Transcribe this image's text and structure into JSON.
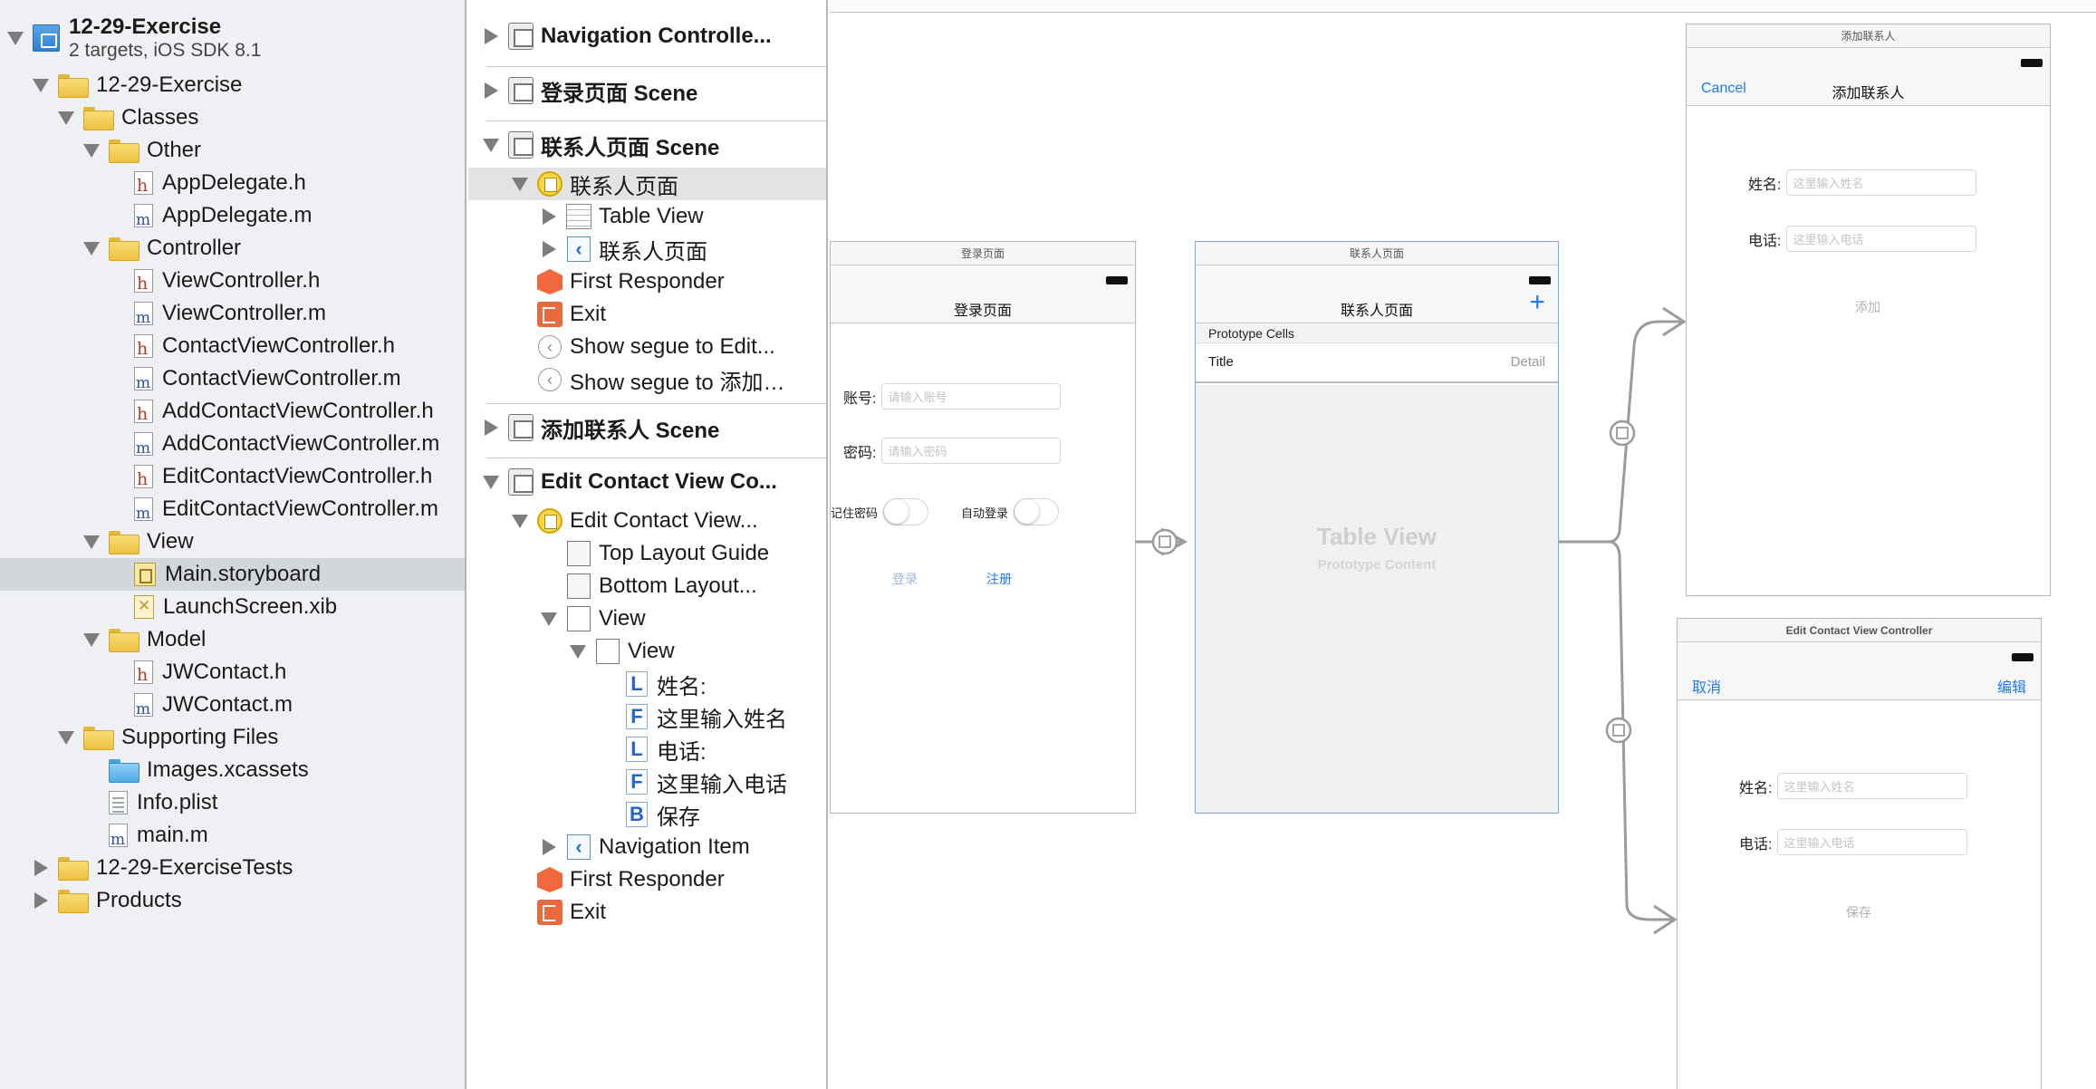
{
  "navigator": {
    "project": {
      "name": "12-29-Exercise",
      "subtitle": "2 targets, iOS SDK 8.1"
    },
    "items": [
      {
        "label": "12-29-Exercise",
        "icon": "folder-icon"
      },
      {
        "label": "Classes",
        "icon": "folder-icon"
      },
      {
        "label": "Other",
        "icon": "folder-icon"
      },
      {
        "label": "AppDelegate.h",
        "icon": "header-file-icon"
      },
      {
        "label": "AppDelegate.m",
        "icon": "source-file-icon"
      },
      {
        "label": "Controller",
        "icon": "folder-icon"
      },
      {
        "label": "ViewController.h",
        "icon": "header-file-icon"
      },
      {
        "label": "ViewController.m",
        "icon": "source-file-icon"
      },
      {
        "label": "ContactViewController.h",
        "icon": "header-file-icon"
      },
      {
        "label": "ContactViewController.m",
        "icon": "source-file-icon"
      },
      {
        "label": "AddContactViewController.h",
        "icon": "header-file-icon"
      },
      {
        "label": "AddContactViewController.m",
        "icon": "source-file-icon"
      },
      {
        "label": "EditContactViewController.h",
        "icon": "header-file-icon"
      },
      {
        "label": "EditContactViewController.m",
        "icon": "source-file-icon"
      },
      {
        "label": "View",
        "icon": "folder-icon"
      },
      {
        "label": "Main.storyboard",
        "icon": "storyboard-file-icon"
      },
      {
        "label": "LaunchScreen.xib",
        "icon": "xib-file-icon"
      },
      {
        "label": "Model",
        "icon": "folder-icon"
      },
      {
        "label": "JWContact.h",
        "icon": "header-file-icon"
      },
      {
        "label": "JWContact.m",
        "icon": "source-file-icon"
      },
      {
        "label": "Supporting Files",
        "icon": "folder-icon"
      },
      {
        "label": "Images.xcassets",
        "icon": "asset-catalog-icon"
      },
      {
        "label": "Info.plist",
        "icon": "plist-file-icon"
      },
      {
        "label": "main.m",
        "icon": "source-file-icon"
      },
      {
        "label": "12-29-ExerciseTests",
        "icon": "folder-icon"
      },
      {
        "label": "Products",
        "icon": "folder-icon"
      }
    ]
  },
  "outline": {
    "items": [
      {
        "label": "Navigation Controlle...",
        "icon": "scene-icon"
      },
      {
        "label": "登录页面 Scene",
        "icon": "scene-icon"
      },
      {
        "label": "联系人页面 Scene",
        "icon": "scene-icon"
      },
      {
        "label": "联系人页面",
        "icon": "view-controller-icon"
      },
      {
        "label": "Table View",
        "icon": "table-view-icon"
      },
      {
        "label": "联系人页面",
        "icon": "navigation-item-icon"
      },
      {
        "label": "First Responder",
        "icon": "first-responder-icon"
      },
      {
        "label": "Exit",
        "icon": "exit-icon"
      },
      {
        "label": "Show segue to Edit...",
        "icon": "segue-icon"
      },
      {
        "label": "Show segue to 添加…",
        "icon": "segue-icon"
      },
      {
        "label": "添加联系人 Scene",
        "icon": "scene-icon"
      },
      {
        "label": "Edit Contact View Co...",
        "icon": "scene-icon"
      },
      {
        "label": "Edit Contact View...",
        "icon": "view-controller-icon"
      },
      {
        "label": "Top Layout Guide",
        "icon": "layout-guide-icon"
      },
      {
        "label": "Bottom Layout...",
        "icon": "layout-guide-icon"
      },
      {
        "label": "View",
        "icon": "view-icon"
      },
      {
        "label": "View",
        "icon": "view-icon"
      },
      {
        "label": "姓名:",
        "icon": "label-icon"
      },
      {
        "label": "这里输入姓名",
        "icon": "text-field-icon"
      },
      {
        "label": "电话:",
        "icon": "label-icon"
      },
      {
        "label": "这里输入电话",
        "icon": "text-field-icon"
      },
      {
        "label": "保存",
        "icon": "button-icon"
      },
      {
        "label": "Navigation Item",
        "icon": "navigation-item-icon"
      },
      {
        "label": "First Responder",
        "icon": "first-responder-icon"
      },
      {
        "label": "Exit",
        "icon": "exit-icon"
      }
    ]
  },
  "canvas": {
    "login": {
      "scene_title": "登录页面",
      "nav_title": "登录页面",
      "account_label": "账号:",
      "account_placeholder": "请输入账号",
      "password_label": "密码:",
      "password_placeholder": "请输入密码",
      "remember_label": "记住密码",
      "autologin_label": "自动登录",
      "login_button": "登录",
      "register_button": "注册"
    },
    "contacts": {
      "scene_title": "联系人页面",
      "nav_title": "联系人页面",
      "add_icon": "+",
      "prototype_cells": "Prototype Cells",
      "cell_title": "Title",
      "cell_detail": "Detail",
      "table_view_label": "Table View",
      "table_view_sub": "Prototype Content"
    },
    "add_contact": {
      "scene_title": "添加联系人",
      "nav_title": "添加联系人",
      "cancel_button": "Cancel",
      "name_label": "姓名:",
      "name_placeholder": "这里输入姓名",
      "phone_label": "电话:",
      "phone_placeholder": "这里输入电话",
      "add_button": "添加"
    },
    "edit_contact": {
      "scene_title": "Edit Contact View Controller",
      "cancel_button": "取消",
      "edit_button": "编辑",
      "name_label": "姓名:",
      "name_placeholder": "这里输入姓名",
      "phone_label": "电话:",
      "phone_placeholder": "这里输入电话",
      "save_button": "保存"
    }
  },
  "colors": {
    "tint": "#1e7bf0",
    "selection": "#d3d6da",
    "navigator_bg": "#eef0f3",
    "segue_line": "#9b9b9b"
  }
}
